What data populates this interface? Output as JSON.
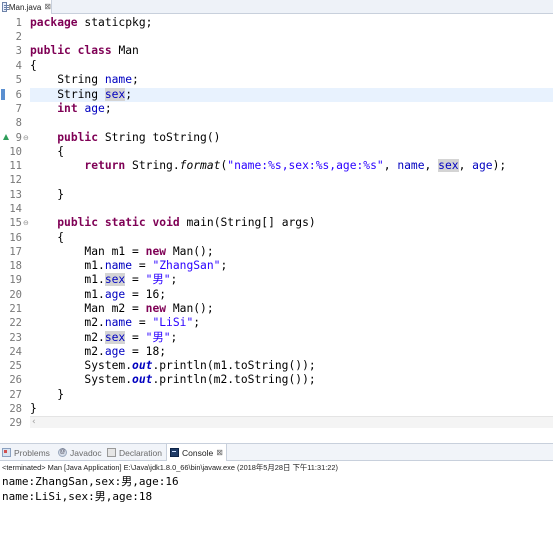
{
  "editor": {
    "tab_label": "Man.java",
    "tab_close": "⊠"
  },
  "code": {
    "line_numbers": [
      "1",
      "2",
      "3",
      "4",
      "5",
      "6",
      "7",
      "8",
      "9",
      "10",
      "11",
      "12",
      "13",
      "14",
      "15",
      "16",
      "17",
      "18",
      "19",
      "20",
      "21",
      "22",
      "23",
      "24",
      "25",
      "26",
      "27",
      "28",
      "29"
    ],
    "l1": {
      "kw": "package",
      "rest": " staticpkg;"
    },
    "l3": {
      "kw1": "public",
      "kw2": "class",
      "rest": " Man"
    },
    "l4": "{",
    "l5": {
      "type": "String ",
      "field": "name",
      "semi": ";"
    },
    "l6": {
      "type": "String ",
      "field": "sex",
      "semi": ";"
    },
    "l7": {
      "kw": "int",
      "sp": " ",
      "field": "age",
      "semi": ";"
    },
    "l9": {
      "kw": "public",
      "rest": " String toString()"
    },
    "l10": "{",
    "l11": {
      "kw": "return",
      "a": " String.",
      "method": "format",
      "b": "(",
      "str": "\"name:%s,sex:%s,age:%s\"",
      "c": ", ",
      "f1": "name",
      "d": ", ",
      "f2": "sex",
      "e": ", ",
      "f3": "age",
      "f": ");"
    },
    "l13": "}",
    "l15": {
      "kw1": "public",
      "kw2": "static",
      "kw3": "void",
      "rest": " main(String[] args)"
    },
    "l16": "{",
    "l17": {
      "a": "Man m1 = ",
      "kw": "new",
      "b": " Man();"
    },
    "l18": {
      "obj": "m1.",
      "field": "name",
      "eq": " = ",
      "str": "\"ZhangSan\"",
      "semi": ";"
    },
    "l19": {
      "obj": "m1.",
      "field": "sex",
      "eq": " = ",
      "str": "\"男\"",
      "semi": ";"
    },
    "l20": {
      "obj": "m1.",
      "field": "age",
      "rest": " = 16;"
    },
    "l21": {
      "a": "Man m2 = ",
      "kw": "new",
      "b": " Man();"
    },
    "l22": {
      "obj": "m2.",
      "field": "name",
      "eq": " = ",
      "str": "\"LiSi\"",
      "semi": ";"
    },
    "l23": {
      "obj": "m2.",
      "field": "sex",
      "eq": " = ",
      "str": "\"男\"",
      "semi": ";"
    },
    "l24": {
      "obj": "m2.",
      "field": "age",
      "rest": " = 18;"
    },
    "l25": {
      "a": "System.",
      "out": "out",
      "b": ".println(m1.toString());"
    },
    "l26": {
      "a": "System.",
      "out": "out",
      "b": ".println(m2.toString());"
    },
    "l27": "}",
    "l28": "}"
  },
  "panel": {
    "tabs": [
      {
        "label": "Problems",
        "icon": "problems-icon"
      },
      {
        "label": "Javadoc",
        "icon": "javadoc-icon"
      },
      {
        "label": "Declaration",
        "icon": "declaration-icon"
      },
      {
        "label": "Console",
        "icon": "console-icon",
        "close": "⊠"
      }
    ]
  },
  "console": {
    "status": "<terminated> Man [Java Application] E:\\Java\\jdk1.8.0_66\\bin\\javaw.exe (2018年5月28日 下午11:31:22)",
    "output": [
      "name:ZhangSan,sex:男,age:16",
      "name:LiSi,sex:男,age:18"
    ]
  },
  "colors": {
    "keyword": "#7f0055",
    "field": "#0000c0",
    "string": "#2a00ff",
    "current_line": "#e8f2fe",
    "occurrence_highlight": "#d4d4d4"
  }
}
